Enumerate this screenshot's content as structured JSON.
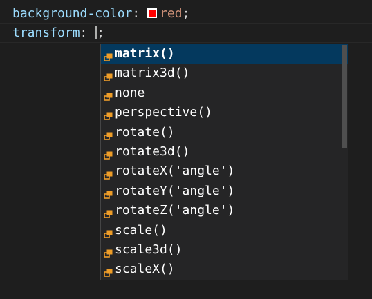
{
  "editor": {
    "line1": {
      "property": "background-color",
      "colon": ":",
      "swatch_color": "#ff0000",
      "value": "red",
      "semicolon": ";"
    },
    "line2": {
      "property": "transform",
      "colon": ":",
      "semicolon": ";"
    }
  },
  "suggestions": {
    "items": [
      {
        "label": "matrix()",
        "selected": true
      },
      {
        "label": "matrix3d()"
      },
      {
        "label": "none"
      },
      {
        "label": "perspective()"
      },
      {
        "label": "rotate()"
      },
      {
        "label": "rotate3d()"
      },
      {
        "label": "rotateX('angle')"
      },
      {
        "label": "rotateY('angle')"
      },
      {
        "label": "rotateZ('angle')"
      },
      {
        "label": "scale()"
      },
      {
        "label": "scale3d()"
      },
      {
        "label": "scaleX()"
      }
    ],
    "icon": "value-icon",
    "icon_color": "#ee9d28"
  }
}
